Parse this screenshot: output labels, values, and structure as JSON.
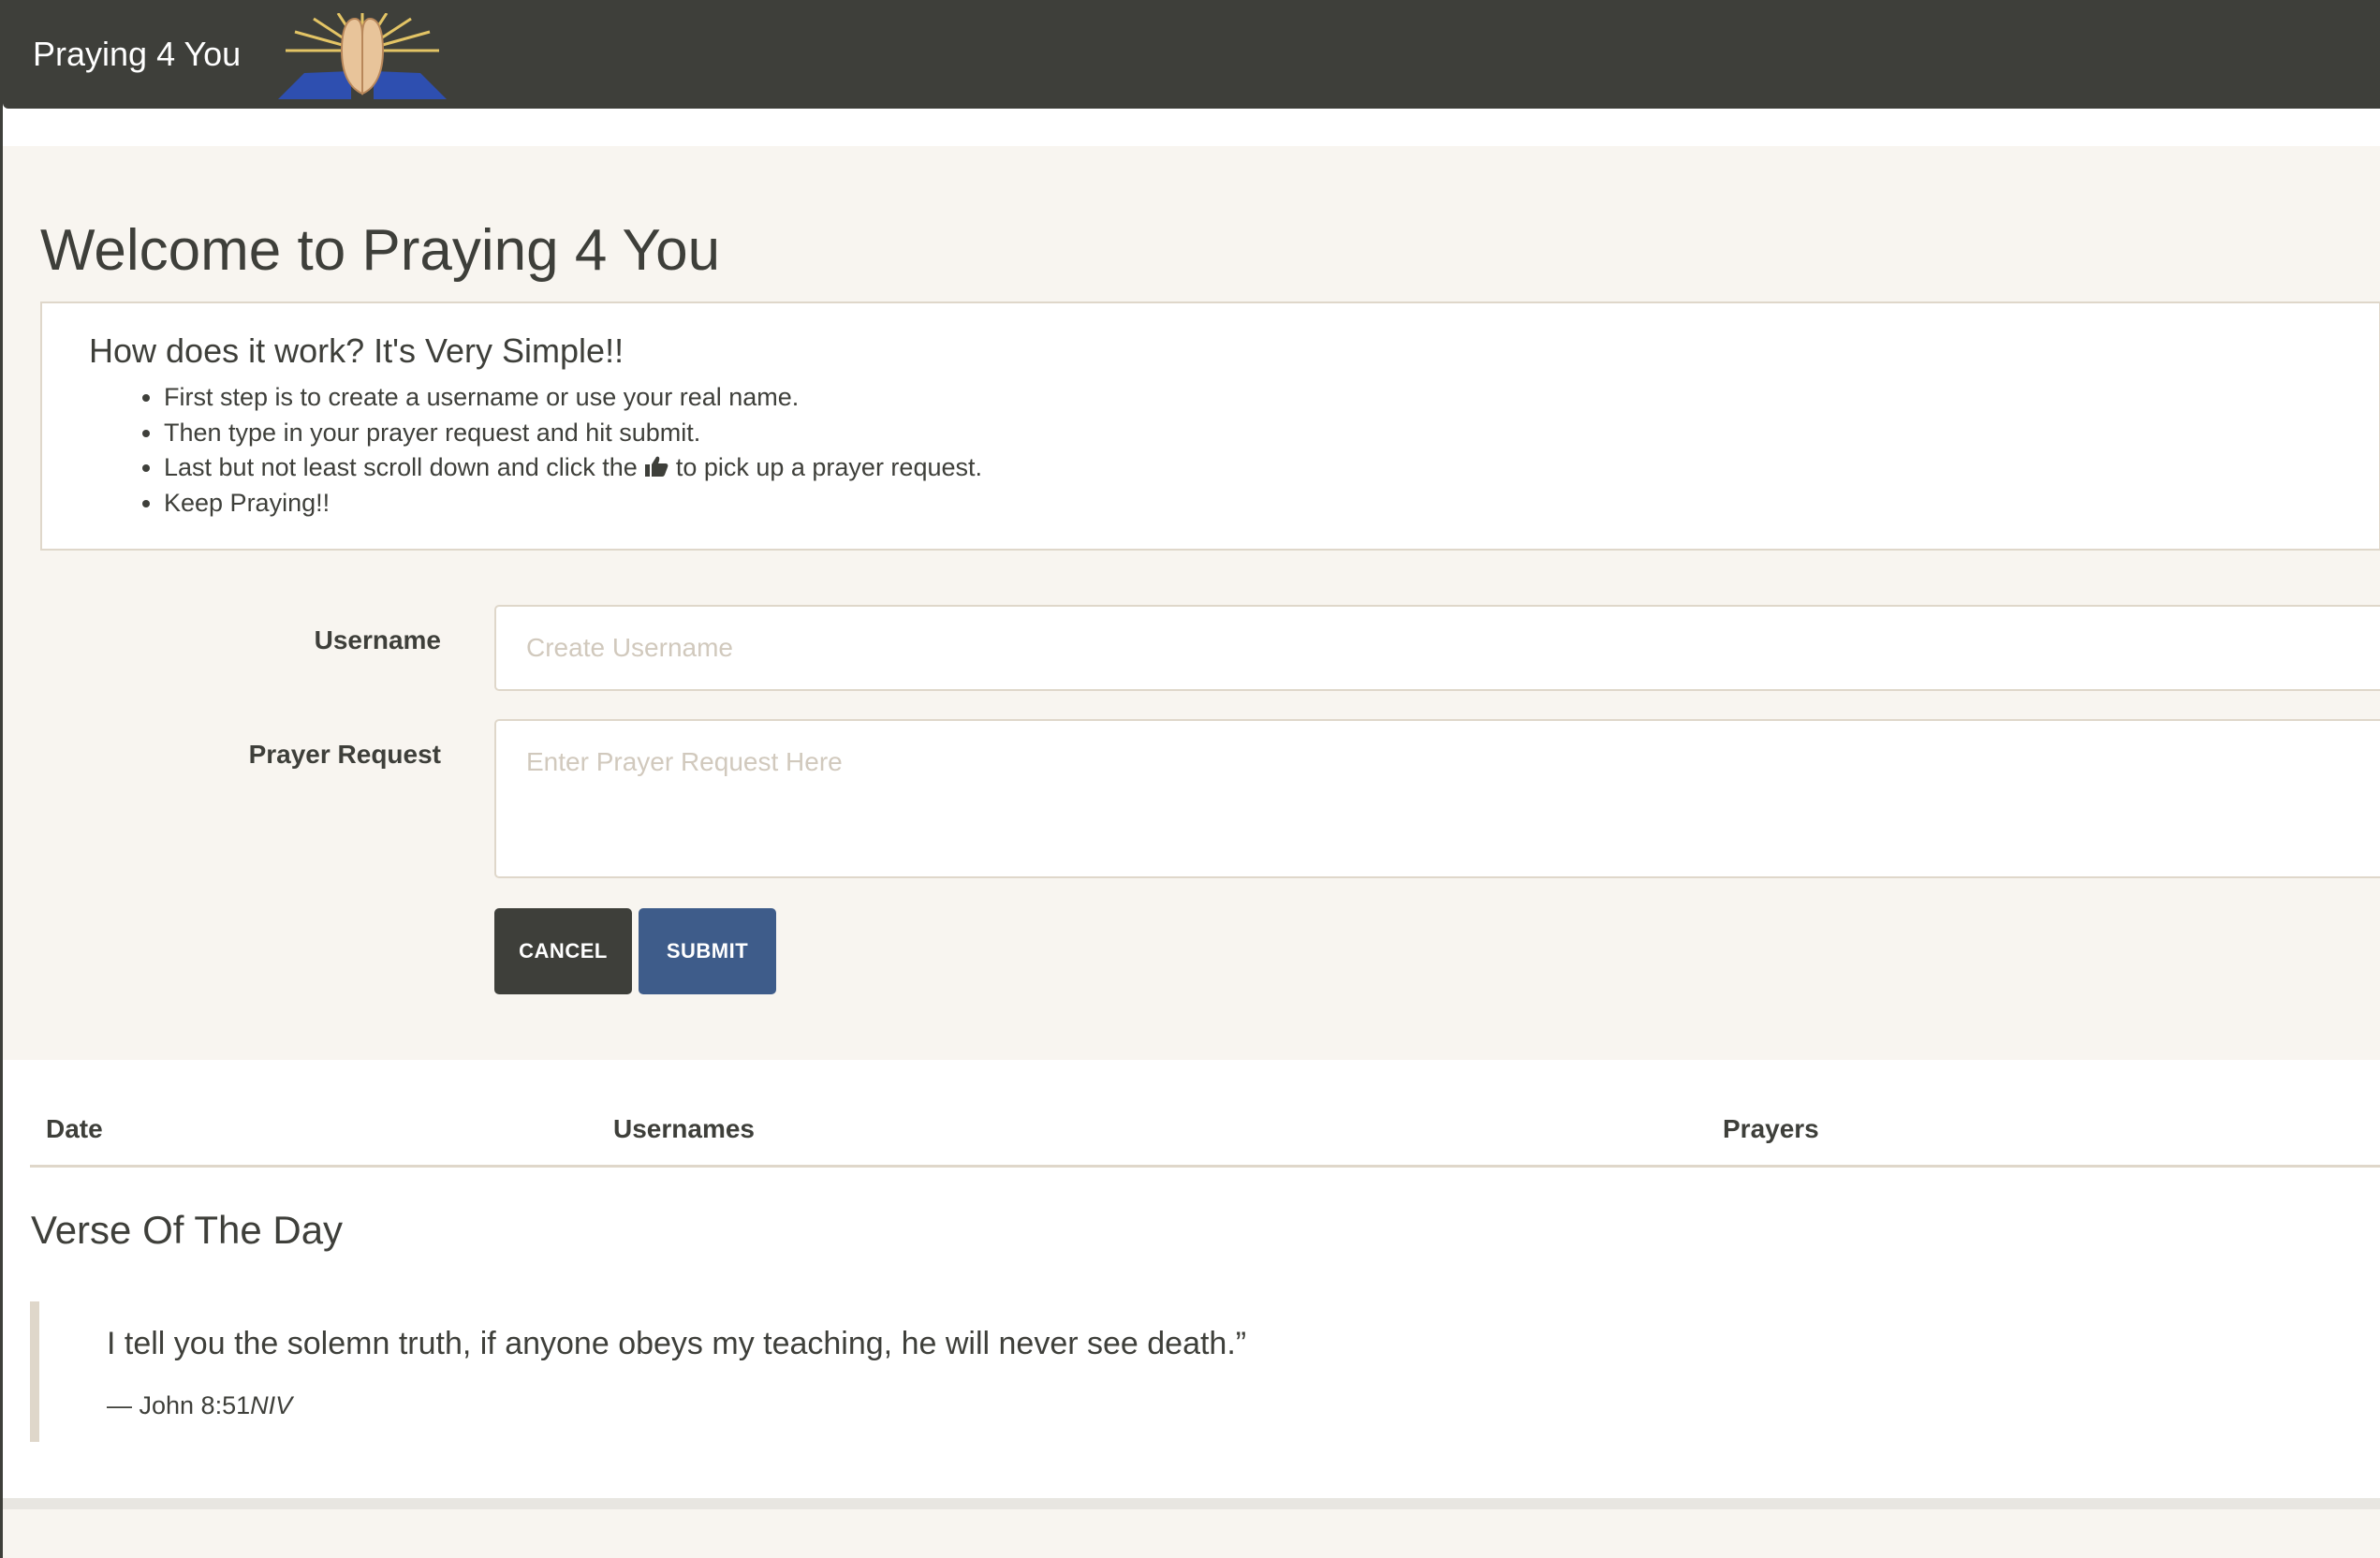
{
  "navbar": {
    "brand": "Praying 4 You",
    "logo_icon": "praying-hands-icon"
  },
  "jumbotron": {
    "title": "Welcome to Praying 4 You",
    "how_heading": "How does it work? It's Very Simple!!",
    "steps": {
      "s1": "First step is to create a username or use your real name.",
      "s2": "Then type in your prayer request and hit submit.",
      "s3_before": "Last but not least scroll down and click the",
      "s3_icon": "thumbs-up-icon",
      "s3_after": "to pick up a prayer request.",
      "s4": "Keep Praying!!"
    }
  },
  "form": {
    "username_label": "Username",
    "username_placeholder": "Create Username",
    "username_value": "",
    "prayer_label": "Prayer Request",
    "prayer_placeholder": "Enter Prayer Request Here",
    "prayer_value": "",
    "cancel_label": "CANCEL",
    "submit_label": "SUBMIT"
  },
  "table": {
    "headers": {
      "date": "Date",
      "usernames": "Usernames",
      "prayers": "Prayers"
    }
  },
  "verse": {
    "title": "Verse Of The Day",
    "text": "I tell you the solemn truth, if anyone obeys my teaching, he will never see death.”",
    "reference": "— John 8:51",
    "version": "NIV"
  },
  "colors": {
    "navbar": "#3e3f3a",
    "jumbotron": "#f8f5f0",
    "submit": "#3e5c8a",
    "border": "#dfd7ca"
  }
}
